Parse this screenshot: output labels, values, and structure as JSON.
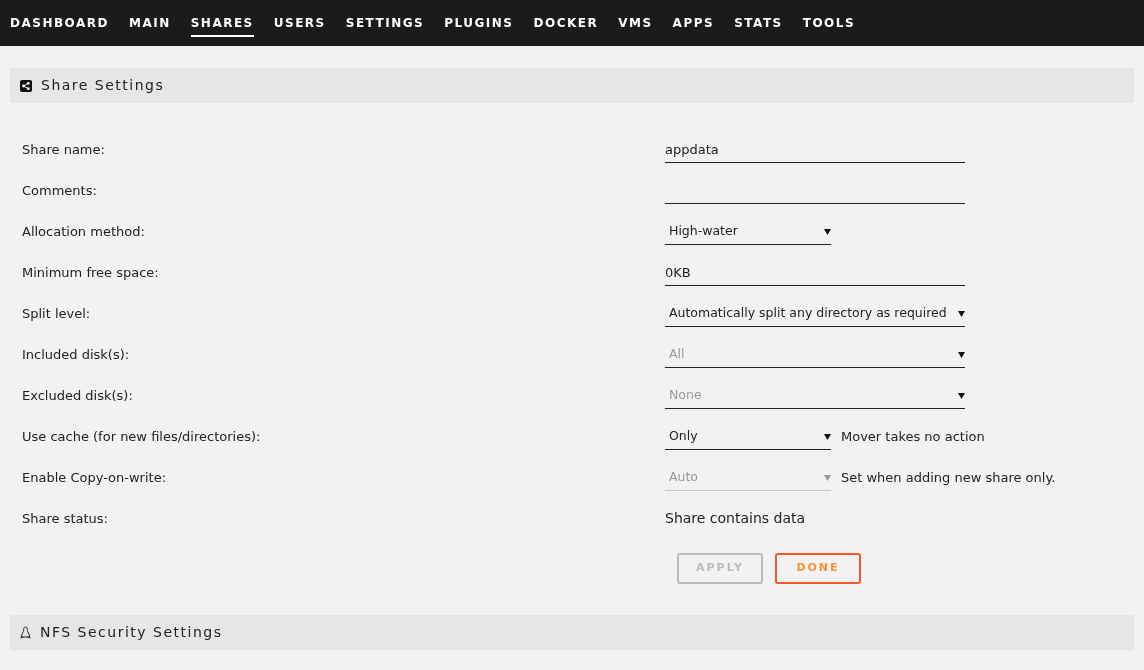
{
  "nav": [
    {
      "label": "DASHBOARD",
      "selected": false
    },
    {
      "label": "MAIN",
      "selected": false
    },
    {
      "label": "SHARES",
      "selected": true
    },
    {
      "label": "USERS",
      "selected": false
    },
    {
      "label": "SETTINGS",
      "selected": false
    },
    {
      "label": "PLUGINS",
      "selected": false
    },
    {
      "label": "DOCKER",
      "selected": false
    },
    {
      "label": "VMS",
      "selected": false
    },
    {
      "label": "APPS",
      "selected": false
    },
    {
      "label": "STATS",
      "selected": false
    },
    {
      "label": "TOOLS",
      "selected": false
    }
  ],
  "share_settings": {
    "title": "Share Settings",
    "rows": [
      {
        "label": "Share name:",
        "kind": "input",
        "narrow": false,
        "value": "appdata",
        "disabled": false
      },
      {
        "label": "Comments:",
        "kind": "input",
        "narrow": false,
        "value": "",
        "disabled": false
      },
      {
        "label": "Allocation method:",
        "kind": "select",
        "narrow": true,
        "value": "High-water",
        "disabled": false
      },
      {
        "label": "Minimum free space:",
        "kind": "input",
        "narrow": false,
        "value": "0KB",
        "disabled": false
      },
      {
        "label": "Split level:",
        "kind": "select",
        "narrow": false,
        "value": "Automatically split any directory as required",
        "disabled": false
      },
      {
        "label": "Included disk(s):",
        "kind": "select",
        "narrow": false,
        "value": "All",
        "disabled": false,
        "muted": true
      },
      {
        "label": "Excluded disk(s):",
        "kind": "select",
        "narrow": false,
        "value": "None",
        "disabled": false,
        "muted": true
      },
      {
        "label": "Use cache (for new files/directories):",
        "kind": "select",
        "narrow": true,
        "value": "Only",
        "disabled": false,
        "note": "Mover takes no action"
      },
      {
        "label": "Enable Copy-on-write:",
        "kind": "select",
        "narrow": true,
        "value": "Auto",
        "disabled": true,
        "note": "Set when adding new share only."
      },
      {
        "label": "Share status:",
        "kind": "text",
        "value": "Share contains data"
      }
    ],
    "buttons": [
      {
        "label": "APPLY",
        "disabled": true
      },
      {
        "label": "DONE",
        "disabled": false
      }
    ]
  },
  "nfs_settings": {
    "title": "NFS Security Settings"
  }
}
